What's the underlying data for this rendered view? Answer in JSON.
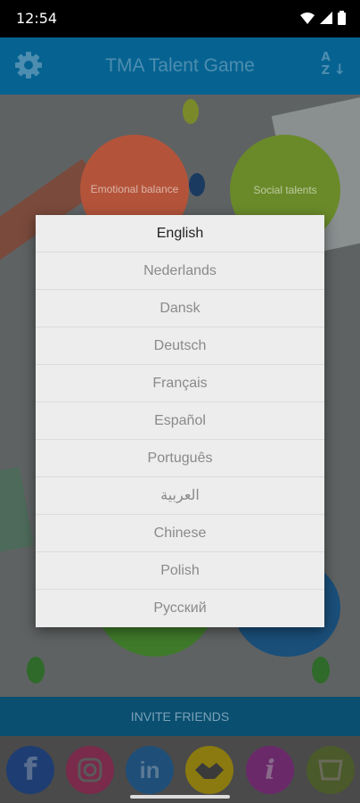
{
  "status": {
    "time": "12:54"
  },
  "app": {
    "title": "TMA Talent Game"
  },
  "board": {
    "circles": [
      {
        "label": "Emotional balance",
        "color": "#b3543a"
      },
      {
        "label": "Social talents",
        "color": "#6a8a2a"
      }
    ]
  },
  "language_dialog": {
    "items": [
      {
        "label": "English",
        "selected": true
      },
      {
        "label": "Nederlands"
      },
      {
        "label": "Dansk"
      },
      {
        "label": "Deutsch"
      },
      {
        "label": "Français"
      },
      {
        "label": "Español"
      },
      {
        "label": "Português"
      },
      {
        "label": "العربية"
      },
      {
        "label": "Chinese"
      },
      {
        "label": "Polish"
      },
      {
        "label": "Русский"
      }
    ]
  },
  "footer": {
    "invite_label": "INVITE FRIENDS",
    "social": [
      {
        "icon": "facebook-icon",
        "glyph": "f",
        "color": "#1e3d72"
      },
      {
        "icon": "instagram-icon",
        "glyph": "◎",
        "color": "#7a2a4a"
      },
      {
        "icon": "linkedin-icon",
        "glyph": "in",
        "color": "#1f4f78"
      },
      {
        "icon": "handshake-icon",
        "glyph": "🤝",
        "color": "#8a7a10"
      },
      {
        "icon": "info-icon",
        "glyph": "i",
        "color": "#6a2a6a"
      },
      {
        "icon": "cards-icon",
        "glyph": "▭",
        "color": "#4a5a2a"
      }
    ]
  }
}
